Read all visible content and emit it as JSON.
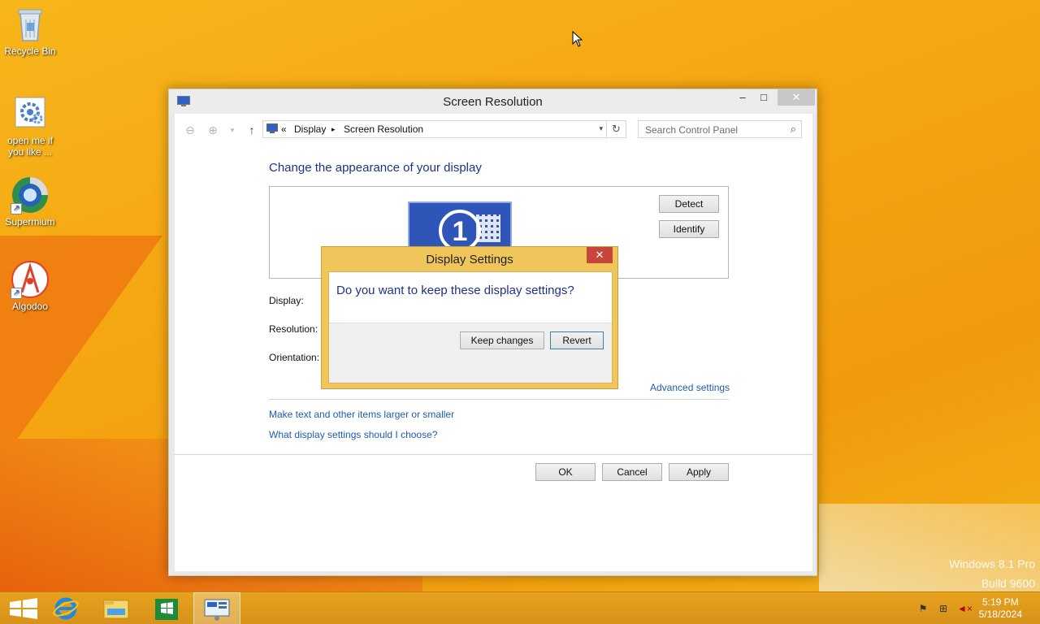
{
  "desktop": {
    "icons": [
      {
        "label": "Recycle Bin"
      },
      {
        "label": "open me if you like ..."
      },
      {
        "label": "Supermium"
      },
      {
        "label": "Algodoo"
      }
    ],
    "watermark": {
      "line1": "Windows 8.1 Pro",
      "line2": "Build 9600"
    }
  },
  "window": {
    "title": "Screen Resolution",
    "minimize": "–",
    "maximize": "□",
    "close": "✕",
    "address": {
      "prefix": "«",
      "crumb1": "Display",
      "separator": "▸",
      "crumb2": "Screen Resolution"
    },
    "search": {
      "placeholder": "Search Control Panel"
    },
    "heading": "Change the appearance of your display",
    "monitor_number": "1",
    "detect_label": "Detect",
    "identify_label": "Identify",
    "labels": {
      "display": "Display:",
      "resolution": "Resolution:",
      "orientation": "Orientation:"
    },
    "advanced_settings": "Advanced settings",
    "links": [
      "Make text and other items larger or smaller",
      "What display settings should I choose?"
    ],
    "buttons": {
      "ok": "OK",
      "cancel": "Cancel",
      "apply": "Apply"
    }
  },
  "dialog": {
    "title": "Display Settings",
    "close": "✕",
    "question": "Do you want to keep these display settings?",
    "keep_label": "Keep changes",
    "revert_label": "Revert"
  },
  "taskbar": {
    "time": "5:19 PM",
    "date": "5/18/2024"
  },
  "colors": {
    "accent": "#f5a512",
    "heading": "#1e3287",
    "link": "#1e5cb3"
  }
}
